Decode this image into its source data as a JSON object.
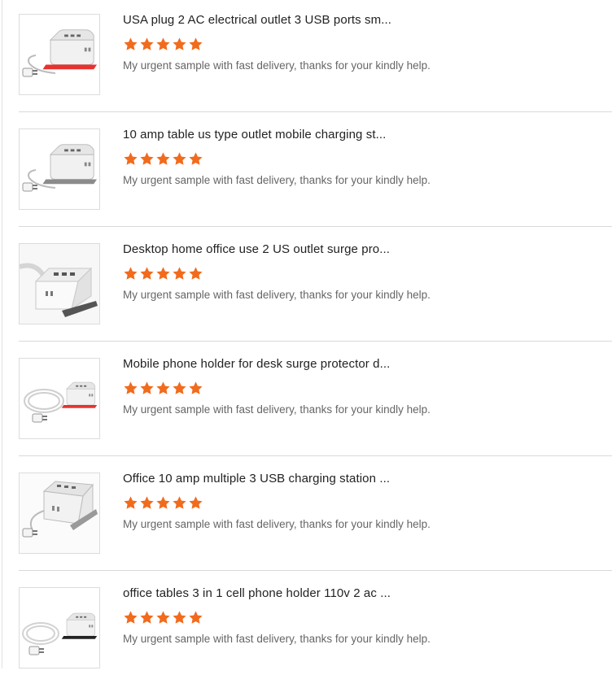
{
  "colors": {
    "star": "#f26b1d",
    "accent_red": "#e8322f",
    "accent_dark": "#333333"
  },
  "reviews": [
    {
      "title": "USA plug 2 AC electrical outlet 3 USB ports sm...",
      "rating": 5,
      "comment": "My urgent sample with fast delivery, thanks for your kindly help.",
      "image": "charger-red-base-plug"
    },
    {
      "title": "10 amp table us type outlet mobile charging st...",
      "rating": 5,
      "comment": "My urgent sample with fast delivery, thanks for your kindly help.",
      "image": "charger-gray-base-plug"
    },
    {
      "title": "Desktop home office use 2 US outlet surge pro...",
      "rating": 5,
      "comment": "My urgent sample with fast delivery, thanks for your kindly help.",
      "image": "charger-closeup"
    },
    {
      "title": "Mobile phone holder for desk surge protector d...",
      "rating": 5,
      "comment": "My urgent sample with fast delivery, thanks for your kindly help.",
      "image": "charger-red-cord"
    },
    {
      "title": "Office 10 amp multiple 3 USB charging station ...",
      "rating": 5,
      "comment": "My urgent sample with fast delivery, thanks for your kindly help.",
      "image": "charger-angled-plug"
    },
    {
      "title": "office tables 3 in 1 cell phone holder 110v 2 ac ...",
      "rating": 5,
      "comment": "My urgent sample with fast delivery, thanks for your kindly help.",
      "image": "charger-black-cord"
    }
  ]
}
